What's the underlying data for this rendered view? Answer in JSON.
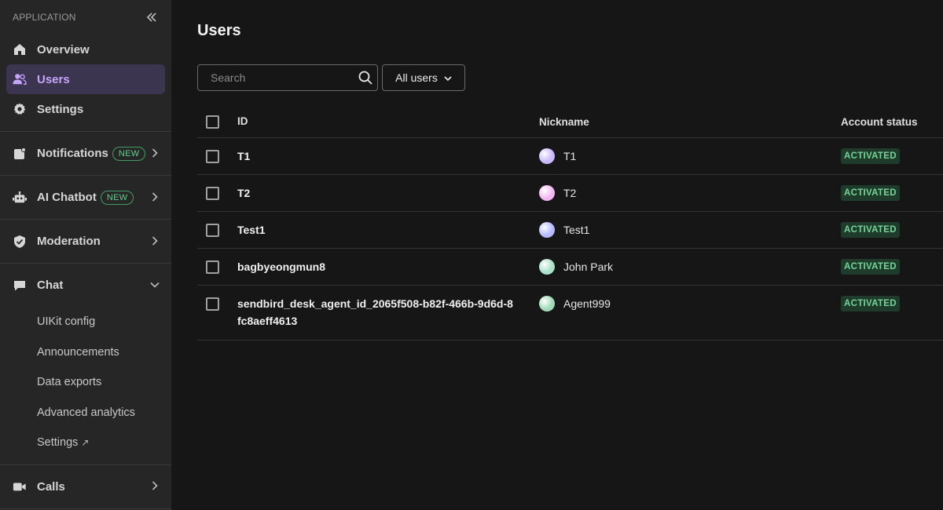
{
  "sidebar": {
    "section_label": "APPLICATION",
    "top_items": [
      {
        "label": "Overview",
        "icon": "home-icon"
      },
      {
        "label": "Users",
        "icon": "users-icon",
        "active": true
      },
      {
        "label": "Settings",
        "icon": "gear-icon"
      }
    ],
    "groups": [
      {
        "label": "Notifications",
        "icon": "notification-icon",
        "badge": "NEW"
      },
      {
        "label": "AI Chatbot",
        "icon": "robot-icon",
        "badge": "NEW"
      },
      {
        "label": "Moderation",
        "icon": "shield-icon"
      },
      {
        "label": "Chat",
        "icon": "chat-icon",
        "expanded": true
      },
      {
        "label": "Calls",
        "icon": "video-icon"
      }
    ],
    "chat_sub_items": [
      {
        "label": "UIKit config"
      },
      {
        "label": "Announcements"
      },
      {
        "label": "Data exports"
      },
      {
        "label": "Advanced analytics"
      },
      {
        "label": "Settings",
        "external": "↗"
      }
    ]
  },
  "main": {
    "title": "Users",
    "search": {
      "placeholder": "Search",
      "value": ""
    },
    "filter": {
      "label": "All users"
    },
    "table": {
      "columns": {
        "id": "ID",
        "nickname": "Nickname",
        "status": "Account status"
      },
      "rows": [
        {
          "id": "T1",
          "nickname": "T1",
          "status": "ACTIVATED",
          "avatar_color": "#c9b8ff"
        },
        {
          "id": "T2",
          "nickname": "T2",
          "status": "ACTIVATED",
          "avatar_color": "#f2b6f0"
        },
        {
          "id": "Test1",
          "nickname": "Test1",
          "status": "ACTIVATED",
          "avatar_color": "#b5b9ff"
        },
        {
          "id": "bagbyeongmun8",
          "nickname": "John Park",
          "status": "ACTIVATED",
          "avatar_color": "#a8e0c8"
        },
        {
          "id": "sendbird_desk_agent_id_2065f508-b82f-466b-9d6d-8fc8aeff4613",
          "nickname": "Agent999",
          "status": "ACTIVATED",
          "avatar_color": "#9fd9b8"
        }
      ]
    }
  },
  "colors": {
    "accent": "#c7a5ff",
    "active_bg": "#3b354f",
    "new_badge": "#5fcf8a",
    "status_text": "#75d597",
    "status_bg": "#1e3b2b"
  }
}
